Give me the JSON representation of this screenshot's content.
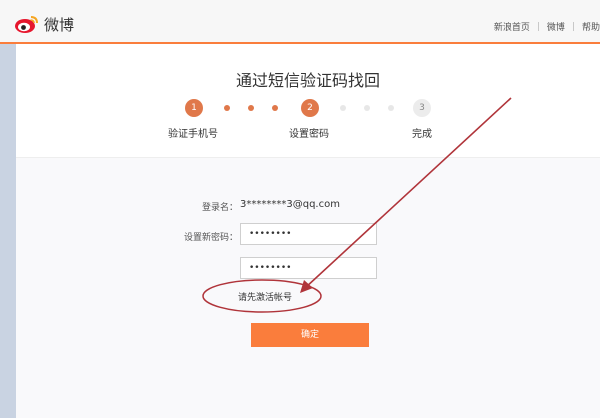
{
  "header": {
    "logo_text": "微博",
    "nav": [
      "新浪首页",
      "微博",
      "帮助"
    ]
  },
  "page": {
    "title": "通过短信验证码找回"
  },
  "steps": [
    {
      "number": "1",
      "label": "验证手机号",
      "state": "done"
    },
    {
      "number": "2",
      "label": "设置密码",
      "state": "current"
    },
    {
      "number": "3",
      "label": "完成",
      "state": "todo"
    }
  ],
  "form": {
    "login_label": "登录名：",
    "login_value": "3********3@qq.com",
    "new_password_label": "设置新密码：",
    "new_password_value": "••••••••",
    "confirm_password_value": "••••••••",
    "warning": "请先激活帐号",
    "submit_label": "确定"
  },
  "colors": {
    "accent": "#fa7d3c",
    "step_active": "#e0784a",
    "annotation": "#b0343a"
  }
}
